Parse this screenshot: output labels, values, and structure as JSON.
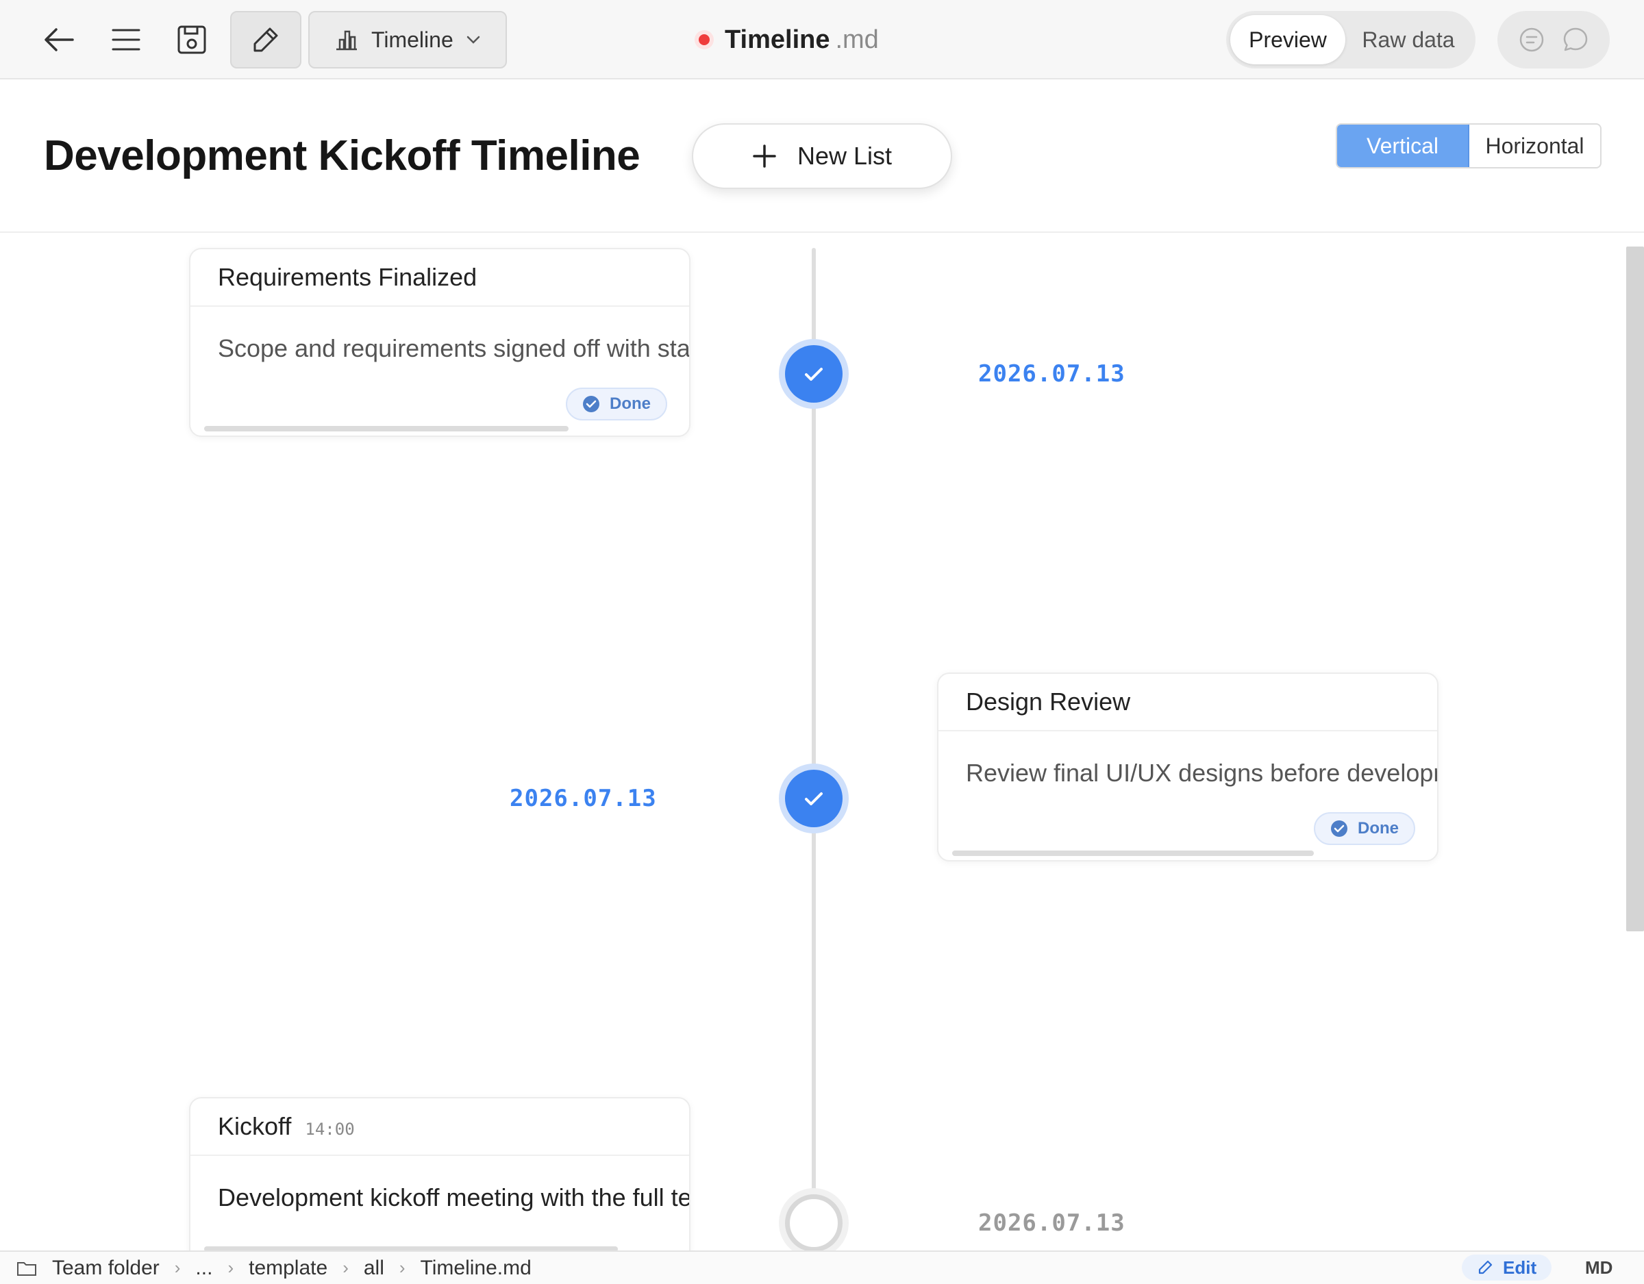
{
  "toolbar": {
    "view_select": "Timeline",
    "doc_name": "Timeline",
    "doc_ext": ".md",
    "modes": {
      "preview": "Preview",
      "raw": "Raw data",
      "active": "Preview"
    }
  },
  "header": {
    "title": "Development Kickoff Timeline",
    "new_list": "New List",
    "orientation": {
      "vertical": "Vertical",
      "horizontal": "Horizontal",
      "active": "Vertical"
    }
  },
  "timeline": {
    "events": [
      {
        "title": "Requirements Finalized",
        "time": "",
        "description": "Scope and requirements signed off with stakeholders",
        "status": "Done",
        "date": "2026.07.13"
      },
      {
        "title": "Design Review",
        "time": "",
        "description": "Review final UI/UX designs before development",
        "status": "Done",
        "date": "2026.07.13"
      },
      {
        "title": "Kickoff",
        "time": "14:00",
        "description": "Development kickoff meeting with the full team",
        "status": "",
        "date": "2026.07.13"
      }
    ]
  },
  "statusbar": {
    "breadcrumb": [
      "Team folder",
      "...",
      "template",
      "all",
      "Timeline.md"
    ],
    "edit": "Edit",
    "format": "MD"
  },
  "colors": {
    "accent": "#3b82f0",
    "unsaved": "#ef3b3b",
    "orientation_active": "#6aa4f1"
  }
}
